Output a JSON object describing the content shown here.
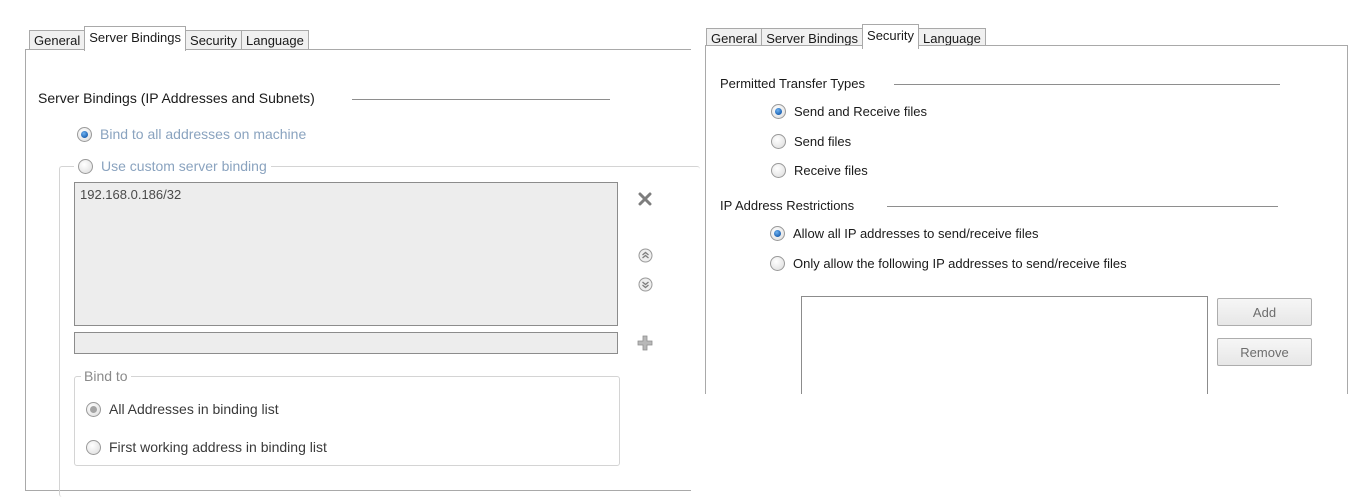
{
  "left_panel": {
    "tabs": [
      "General",
      "Server Bindings",
      "Security",
      "Language"
    ],
    "active_tab": "Server Bindings",
    "section_title": "Server Bindings (IP Addresses and Subnets)",
    "bind_all_label": "Bind to all addresses on machine",
    "custom_binding_label": "Use custom server binding",
    "binding_list": [
      "192.168.0.186/32"
    ],
    "new_binding_value": "",
    "bind_to": {
      "legend": "Bind to",
      "all_addresses_label": "All Addresses in binding list",
      "first_working_label": "First working address in binding list"
    },
    "icons": {
      "remove": "close-icon",
      "move_up": "chevron-up-circle-icon",
      "move_down": "chevron-down-circle-icon",
      "add": "plus-icon"
    }
  },
  "right_panel": {
    "tabs": [
      "General",
      "Server Bindings",
      "Security",
      "Language"
    ],
    "active_tab": "Security",
    "transfer_types": {
      "title": "Permitted Transfer Types",
      "options": [
        "Send and Receive files",
        "Send files",
        "Receive files"
      ],
      "selected": "Send and Receive files"
    },
    "ip_restrictions": {
      "title": "IP Address Restrictions",
      "options": [
        "Allow all IP addresses to send/receive files",
        "Only allow the following IP addresses to send/receive files"
      ],
      "selected": "Allow all IP addresses to send/receive files"
    },
    "add_button": "Add",
    "remove_button": "Remove"
  },
  "colors": {
    "radio_selected": "#1e64b4",
    "disabled_text": "#8aa3bf",
    "list_background": "#ededed",
    "border": "#a9a9a9"
  }
}
